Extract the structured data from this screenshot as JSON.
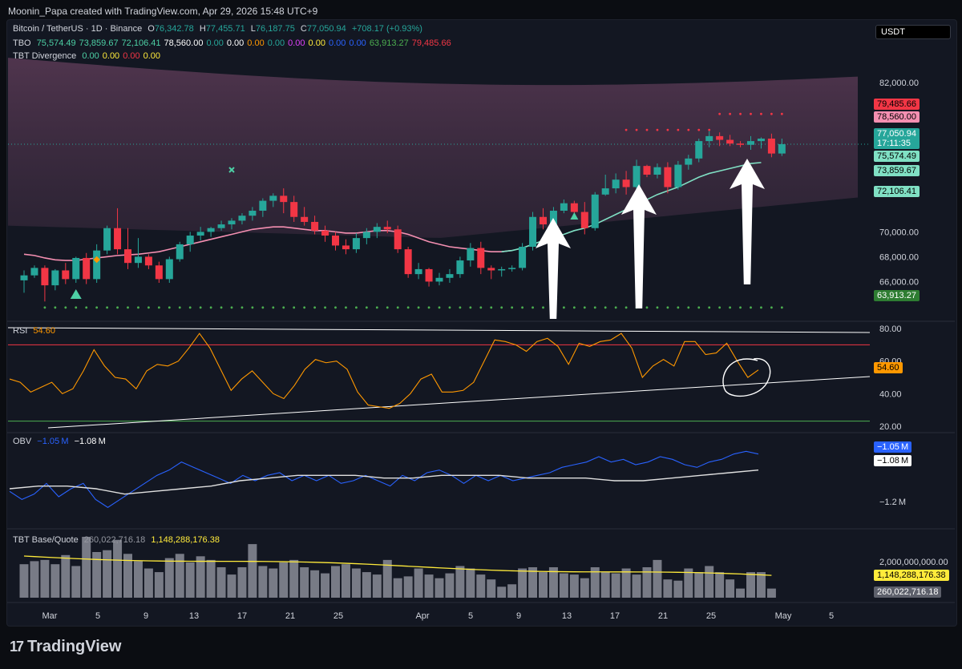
{
  "header": {
    "author_line": "Moonin_Papa created with TradingView.com, Apr 29, 2026 15:48 UTC+9",
    "currency_button": "USDT",
    "brand": "TradingView"
  },
  "legend": {
    "main": {
      "symbol": "Bitcoin / TetherUS · 1D · Binance",
      "o_label": "O",
      "o": "76,342.78",
      "h_label": "H",
      "h": "77,455.71",
      "l_label": "L",
      "l": "76,187.75",
      "c_label": "C",
      "c": "77,050.94",
      "change": "+708.17 (+0.93%)"
    },
    "tbo": {
      "name": "TBO",
      "values": [
        "75,574.49",
        "73,859.67",
        "72,106.41",
        "78,560.00",
        "0.00",
        "0.00",
        "0.00",
        "0.00",
        "0.00",
        "0.00",
        "0.00",
        "0.00",
        "63,913.27",
        "79,485.66"
      ],
      "colors": [
        "#4dd0a5",
        "#4dd0a5",
        "#4dd0a5",
        "#ffffff",
        "#26a69a",
        "#ffffff",
        "#ff9800",
        "#26a69a",
        "#e040fb",
        "#ffeb3b",
        "#2962ff",
        "#2962ff",
        "#4caf50",
        "#f23645"
      ]
    },
    "divergence": {
      "name": "TBT Divergence",
      "values": [
        "0.00",
        "0.00",
        "0.00",
        "0.00"
      ],
      "colors": [
        "#4dd0a5",
        "#ffeb3b",
        "#f23645",
        "#ffeb3b"
      ]
    }
  },
  "price_axis": {
    "ticks": [
      "82,000.00",
      "70,000.00",
      "68,000.00",
      "66,000.00"
    ],
    "tick_values": [
      82000,
      70000,
      68000,
      66000
    ],
    "labels": [
      {
        "text": "79,485.66",
        "value": 79485.66,
        "bg": "#f23645",
        "fg": "#000000"
      },
      {
        "text": "78,560.00",
        "value": 78560,
        "bg": "#f48fb1",
        "fg": "#000000"
      },
      {
        "text": "77,050.94",
        "value": 77050.94,
        "bg": "#26a69a",
        "fg": "#ffffff",
        "sub": "17:11:35"
      },
      {
        "text": "75,574.49",
        "value": 75574.49,
        "bg": "#80e0c4",
        "fg": "#000000"
      },
      {
        "text": "73,859.67",
        "value": 73859.67,
        "bg": "#80e0c4",
        "fg": "#000000"
      },
      {
        "text": "72,106.41",
        "value": 72106.41,
        "bg": "#80e0c4",
        "fg": "#000000"
      },
      {
        "text": "63,913.27",
        "value": 63913.27,
        "bg": "#2e7d32",
        "fg": "#ffffff"
      }
    ]
  },
  "rsi": {
    "name": "RSI",
    "value": "54.60",
    "ticks": [
      "80.00",
      "60.00",
      "40.00",
      "20.00"
    ],
    "tick_values": [
      80,
      60,
      40,
      20
    ],
    "series": [
      49,
      47,
      41,
      44,
      47,
      40,
      43,
      54,
      67,
      57,
      50,
      49,
      43,
      54,
      58,
      57,
      60,
      68,
      77,
      68,
      55,
      42,
      49,
      54,
      47,
      40,
      37,
      45,
      55,
      61,
      59,
      60,
      55,
      41,
      33,
      32,
      31,
      34,
      40,
      49,
      52,
      41,
      41,
      42,
      47,
      60,
      73,
      72,
      70,
      66,
      72,
      74,
      69,
      58,
      71,
      69,
      72,
      73,
      77,
      68,
      50,
      57,
      61,
      57,
      72,
      72,
      64,
      65,
      71,
      60,
      50,
      54.6
    ]
  },
  "obv": {
    "name": "OBV",
    "value1": "−1.05 M",
    "value2": "−1.08 M",
    "ticks": [
      "−1.2 M"
    ],
    "labels": [
      {
        "text": "−1.05 M",
        "bg": "#2962ff",
        "fg": "#ffffff"
      },
      {
        "text": "−1.08 M",
        "bg": "#ffffff",
        "fg": "#000000"
      }
    ],
    "obv_series": [
      -1.16,
      -1.19,
      -1.17,
      -1.13,
      -1.18,
      -1.15,
      -1.13,
      -1.19,
      -1.22,
      -1.19,
      -1.16,
      -1.13,
      -1.1,
      -1.08,
      -1.05,
      -1.07,
      -1.09,
      -1.11,
      -1.13,
      -1.1,
      -1.12,
      -1.1,
      -1.09,
      -1.12,
      -1.1,
      -1.12,
      -1.1,
      -1.13,
      -1.12,
      -1.1,
      -1.12,
      -1.14,
      -1.1,
      -1.12,
      -1.09,
      -1.08,
      -1.1,
      -1.13,
      -1.1,
      -1.12,
      -1.1,
      -1.12,
      -1.11,
      -1.1,
      -1.09,
      -1.07,
      -1.06,
      -1.05,
      -1.03,
      -1.05,
      -1.04,
      -1.06,
      -1.05,
      -1.03,
      -1.04,
      -1.06,
      -1.07,
      -1.05,
      -1.04,
      -1.02,
      -1.01,
      -1.02
    ],
    "signal_series": [
      -1.15,
      -1.14,
      -1.14,
      -1.15,
      -1.17,
      -1.16,
      -1.15,
      -1.14,
      -1.12,
      -1.11,
      -1.1,
      -1.1,
      -1.1,
      -1.11,
      -1.11,
      -1.1,
      -1.1,
      -1.1,
      -1.11,
      -1.11,
      -1.11,
      -1.12,
      -1.12,
      -1.11,
      -1.1,
      -1.09,
      -1.08
    ]
  },
  "volume": {
    "name": "TBT Base/Quote",
    "value1": "260,022,716.18",
    "value2": "1,148,288,176.38",
    "ticks": [
      "2,000,000,000.00"
    ],
    "labels": [
      {
        "text": "1,148,288,176.38",
        "bg": "#ffeb3b",
        "fg": "#000000"
      },
      {
        "text": "260,022,716.18",
        "bg": "#5d606b",
        "fg": "#ffffff"
      }
    ]
  },
  "time_axis": {
    "labels": [
      "Mar",
      "5",
      "9",
      "13",
      "17",
      "21",
      "25",
      "Apr",
      "5",
      "9",
      "13",
      "17",
      "21",
      "25",
      "May",
      "5"
    ]
  },
  "chart_data": {
    "type": "candlestick",
    "candles": [
      [
        66100,
        66900,
        65100,
        66500
      ],
      [
        66500,
        67300,
        66300,
        67100
      ],
      [
        67100,
        67300,
        64400,
        65700
      ],
      [
        65700,
        67000,
        65300,
        66900
      ],
      [
        66900,
        67500,
        65800,
        66200
      ],
      [
        66200,
        68000,
        65900,
        67900
      ],
      [
        67900,
        68300,
        65800,
        66200
      ],
      [
        66200,
        69000,
        65900,
        68500
      ],
      [
        68500,
        70500,
        68200,
        70300
      ],
      [
        70300,
        71900,
        68200,
        68600
      ],
      [
        68600,
        70300,
        67000,
        67500
      ],
      [
        67500,
        69500,
        67100,
        68000
      ],
      [
        68000,
        68200,
        67000,
        67300
      ],
      [
        67300,
        67600,
        65900,
        66200
      ],
      [
        66200,
        68000,
        65900,
        67800
      ],
      [
        67800,
        69200,
        67600,
        69000
      ],
      [
        69000,
        70000,
        68400,
        69700
      ],
      [
        69700,
        70400,
        69300,
        70000
      ],
      [
        70000,
        70400,
        69600,
        70300
      ],
      [
        70300,
        70900,
        70100,
        70600
      ],
      [
        70600,
        71100,
        70200,
        70900
      ],
      [
        70900,
        71500,
        70600,
        71300
      ],
      [
        71300,
        72000,
        70900,
        71700
      ],
      [
        71700,
        72700,
        71200,
        72500
      ],
      [
        72500,
        73100,
        72000,
        72900
      ],
      [
        72900,
        73500,
        71500,
        72400
      ],
      [
        72400,
        72900,
        70800,
        71200
      ],
      [
        71200,
        72000,
        70500,
        70800
      ],
      [
        70800,
        71300,
        69800,
        70100
      ],
      [
        70100,
        70500,
        69200,
        69700
      ],
      [
        69700,
        70000,
        68500,
        68900
      ],
      [
        68900,
        69400,
        68200,
        68600
      ],
      [
        68600,
        69900,
        68300,
        69500
      ],
      [
        69500,
        70300,
        69000,
        70000
      ],
      [
        70000,
        70700,
        69500,
        70400
      ],
      [
        70400,
        70900,
        69900,
        70200
      ],
      [
        70200,
        70500,
        68300,
        68600
      ],
      [
        68600,
        68800,
        66300,
        66600
      ],
      [
        66600,
        67500,
        66200,
        67000
      ],
      [
        67000,
        67100,
        65600,
        66000
      ],
      [
        66000,
        66700,
        65700,
        66300
      ],
      [
        66300,
        67000,
        65900,
        66600
      ],
      [
        66600,
        68000,
        66300,
        67700
      ],
      [
        67700,
        69100,
        67200,
        68700
      ],
      [
        68700,
        69200,
        66600,
        67100
      ],
      [
        67100,
        67300,
        66200,
        66900
      ],
      [
        66900,
        67200,
        66400,
        67000
      ],
      [
        67000,
        67300,
        66800,
        67100
      ],
      [
        67100,
        69100,
        66900,
        68800
      ],
      [
        68800,
        71600,
        68500,
        71200
      ],
      [
        71200,
        71900,
        70200,
        70600
      ],
      [
        70600,
        72000,
        70300,
        71700
      ],
      [
        71700,
        72600,
        71500,
        72300
      ],
      [
        72300,
        72500,
        71300,
        71600
      ],
      [
        71600,
        72400,
        69800,
        70300
      ],
      [
        70300,
        73200,
        70100,
        73000
      ],
      [
        73000,
        74600,
        72900,
        73500
      ],
      [
        73500,
        74700,
        73100,
        74200
      ],
      [
        74200,
        74900,
        73000,
        73600
      ],
      [
        73600,
        75800,
        73300,
        75300
      ],
      [
        75300,
        75400,
        74400,
        74600
      ],
      [
        74600,
        75500,
        74300,
        75200
      ],
      [
        75200,
        75600,
        73100,
        73600
      ],
      [
        73600,
        75700,
        73400,
        75400
      ],
      [
        75400,
        76200,
        75000,
        75900
      ],
      [
        75900,
        77500,
        75600,
        77300
      ],
      [
        77300,
        78100,
        76800,
        77700
      ],
      [
        77700,
        78000,
        76900,
        77400
      ],
      [
        77400,
        77800,
        76900,
        77100
      ],
      [
        77100,
        77300,
        76800,
        77000
      ],
      [
        77000,
        77700,
        76600,
        77300
      ],
      [
        77300,
        77600,
        76700,
        77500
      ],
      [
        77500,
        77900,
        76000,
        76300
      ],
      [
        76300,
        77500,
        76100,
        77050.94
      ]
    ],
    "ma_fast": [
      68200,
      68100,
      67900,
      67750,
      67700,
      67700,
      67800,
      67900,
      68000,
      68100,
      68150,
      68200,
      68300,
      68400,
      68600,
      68800,
      69000,
      69200,
      69400,
      69600,
      69800,
      70000,
      70200,
      70300,
      70400,
      70400,
      70300,
      70200,
      70100,
      70100,
      70000,
      69900,
      69900,
      70000,
      70100,
      70100,
      70000,
      69800,
      69500,
      69200,
      69000,
      68800,
      68700,
      68600,
      68500,
      68400,
      68400,
      68500,
      68700,
      69000,
      69300,
      69600,
      69800,
      70100,
      70300,
      70600,
      71000,
      71400,
      71800,
      72200,
      72600,
      73000,
      73300,
      73600,
      74000,
      74400,
      74700,
      74900,
      75100,
      75300,
      75500,
      75574
    ]
  }
}
